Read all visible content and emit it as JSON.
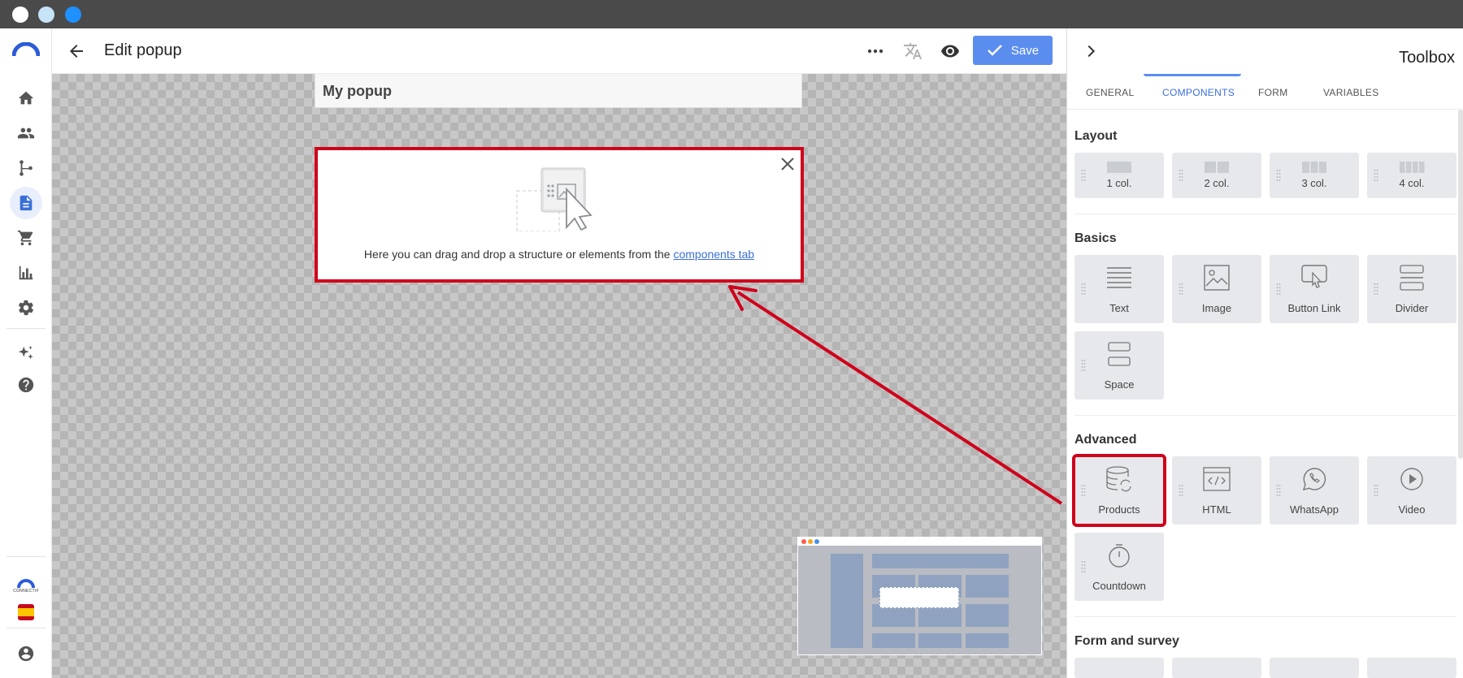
{
  "window": {
    "dots": [
      "#ffffff",
      "#c7e3f8",
      "#1e90ff"
    ]
  },
  "nav": {
    "items": [
      "home-icon",
      "contacts-icon",
      "flows-icon",
      "pages-icon",
      "cart-icon",
      "analytics-icon",
      "settings-icon"
    ],
    "extra": [
      "ai-sparkle-icon",
      "help-icon"
    ],
    "brand_text": "CONNECTIF",
    "language_flag": "es-flag-icon",
    "account_icon": "account-icon"
  },
  "header": {
    "title": "Edit popup",
    "save_label": "Save",
    "icons": [
      "more-icon",
      "translate-icon",
      "preview-eye-icon"
    ]
  },
  "canvas": {
    "popup_name": "My popup",
    "hint_text": "Here you can drag and drop a structure or elements from the ",
    "hint_link": "components tab"
  },
  "toolbox": {
    "title": "Toolbox",
    "tabs": [
      "GENERAL",
      "COMPONENTS",
      "FORM",
      "VARIABLES"
    ],
    "active_tab": "COMPONENTS",
    "sections": {
      "layout": {
        "title": "Layout",
        "items": [
          "1 col.",
          "2 col.",
          "3 col.",
          "4 col."
        ]
      },
      "basics": {
        "title": "Basics",
        "items": [
          "Text",
          "Image",
          "Button Link",
          "Divider",
          "Space"
        ]
      },
      "advanced": {
        "title": "Advanced",
        "items": [
          "Products",
          "HTML",
          "WhatsApp",
          "Video",
          "Countdown"
        ],
        "highlighted": "Products"
      },
      "form_survey": {
        "title": "Form and survey"
      }
    }
  },
  "colors": {
    "accent": "#5b8def",
    "annotation": "#d0021b",
    "titlebar": "#4a4a4a"
  }
}
